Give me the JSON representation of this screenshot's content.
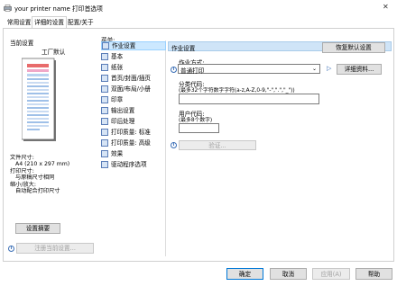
{
  "window": {
    "title": "your printer name 打印首选项",
    "close_glyph": "✕"
  },
  "tabs": [
    {
      "label": "常用设置"
    },
    {
      "label": "详细的设置"
    },
    {
      "label": "配置/关于"
    }
  ],
  "left_panel": {
    "current_settings_label": "当前设置",
    "preset_label": "工厂默认",
    "summary_lines": [
      "文件尺寸:",
      "  A4 (210 x 297 mm)",
      "打印尺寸:",
      "  与原稿尺寸相同",
      "缩小/放大:",
      "  自动配合打印尺寸"
    ],
    "confirm_settings_button": "设置摘要",
    "register_button": "注册当前设置..."
  },
  "menu": {
    "label": "菜单:",
    "items": [
      {
        "label": "作业设置"
      },
      {
        "label": "基本"
      },
      {
        "label": "纸张"
      },
      {
        "label": "首页/封面/插页"
      },
      {
        "label": "双面/布局/小册"
      },
      {
        "label": "印章"
      },
      {
        "label": "输出设置"
      },
      {
        "label": "印后处理"
      },
      {
        "label": "打印质量: 标准"
      },
      {
        "label": "打印质量: 高级"
      },
      {
        "label": "效果"
      },
      {
        "label": "驱动程序选项"
      }
    ],
    "selected_index": 0
  },
  "job_settings": {
    "header": "作业设置",
    "restore_defaults_button": "恢复默认设置",
    "job_type_label": "作业方式:",
    "job_type_value": "普通打印",
    "details_button": "详细资料...",
    "classification_label": "分类代码:",
    "classification_hint": "(最多32个字符数字字符(a-z,A-Z,0-9,\"-\",\".\",\"_\"))",
    "classification_value": "",
    "user_code_label": "用户代码:",
    "user_code_hint": "(最多8个数字)",
    "user_code_value": "",
    "auth_button": "验证..."
  },
  "footer": {
    "ok_button": "确定",
    "cancel_button": "取消",
    "apply_button": "应用(A)",
    "help_button": "帮助"
  },
  "colors": {
    "selected_bg": "#cce8ff",
    "header_bg": "#cfe4f7",
    "button_bg": "#e1e1e1",
    "accent": "#3b6fb6"
  }
}
